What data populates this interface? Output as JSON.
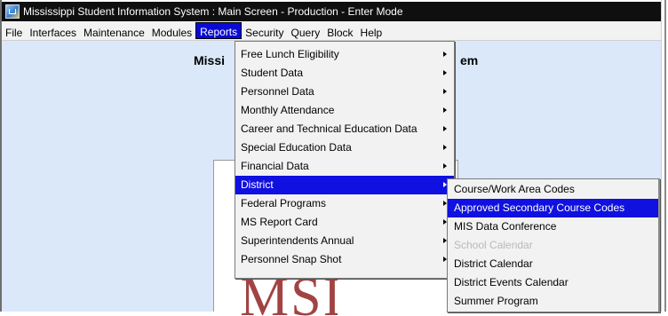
{
  "window": {
    "title": "Mississippi Student Information System : Main Screen  -  Production  -  Enter Mode"
  },
  "menubar": {
    "items": [
      "File",
      "Interfaces",
      "Maintenance",
      "Modules",
      "Reports",
      "Security",
      "Query",
      "Block",
      "Help"
    ],
    "active": "Reports"
  },
  "main": {
    "title_partial": "Missi",
    "title_tail": "em",
    "logo_text": "MSIS"
  },
  "reports_menu": {
    "items": [
      "Free Lunch Eligibility",
      "Student Data",
      "Personnel Data",
      "Monthly Attendance",
      "Career and Technical Education Data",
      "Special Education Data",
      "Financial Data",
      "District",
      "Federal Programs",
      "MS Report Card",
      "Superintendents Annual",
      "Personnel Snap Shot"
    ],
    "highlighted": "District"
  },
  "district_menu": {
    "items": [
      "Course/Work Area Codes",
      "Approved Secondary Course Codes",
      "MIS Data Conference",
      "School Calendar",
      "District Calendar",
      "District Events Calendar",
      "Summer Program"
    ],
    "highlighted": "Approved Secondary Course Codes",
    "disabled": "School Calendar"
  },
  "colors": {
    "title_bar": "#0f0f0f",
    "highlight": "#1010e0",
    "main_background": "#dbe8fa",
    "logo": "#a14343"
  }
}
